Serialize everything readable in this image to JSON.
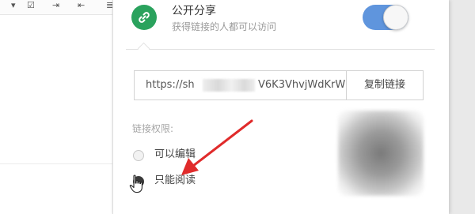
{
  "share": {
    "title": "公开分享",
    "subtitle": "获得链接的人都可以访问",
    "toggle_on": true,
    "accent_color": "#5f95dd",
    "icon_color": "#2aa25d"
  },
  "link": {
    "url_prefix": "https://sh",
    "url_suffix": "V6K3VhvjWdKrW",
    "copy_label": "复制链接"
  },
  "permissions": {
    "label": "链接权限:",
    "options": [
      {
        "label": "可以编辑",
        "selected": false
      },
      {
        "label": "只能阅读",
        "selected": true
      }
    ]
  },
  "annotation": {
    "arrow_color": "#e02b2b"
  }
}
